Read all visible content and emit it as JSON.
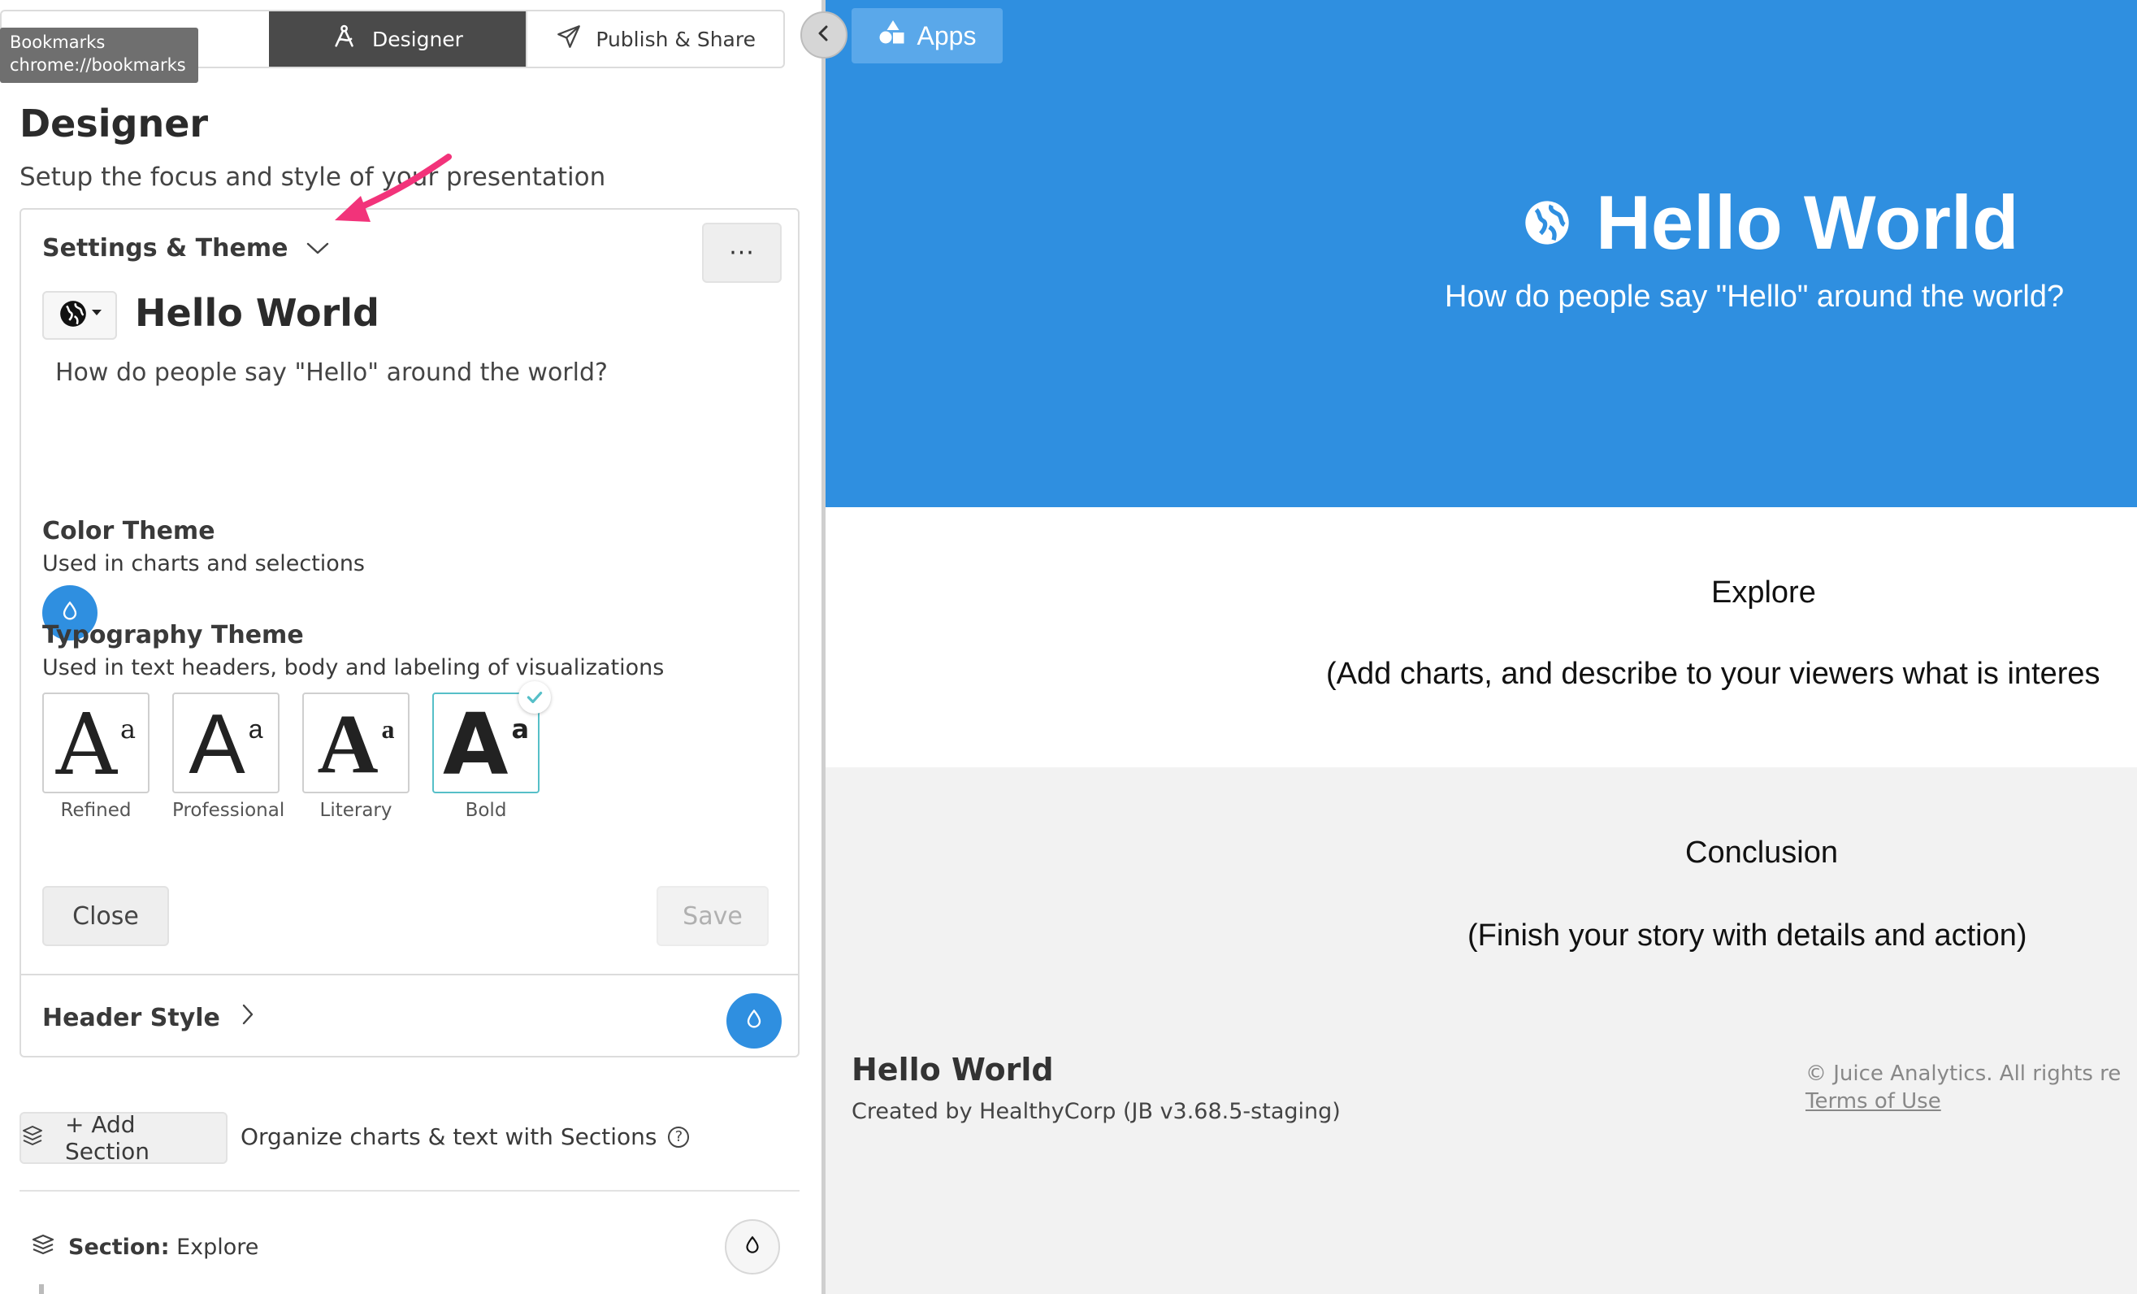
{
  "tabs": {
    "designer_label": "Designer",
    "publish_label": "Publish & Share"
  },
  "tooltip": {
    "line1": "Bookmarks",
    "line2": "chrome://bookmarks"
  },
  "designer": {
    "title": "Designer",
    "subtitle": "Setup the focus and style of your presentation"
  },
  "settings": {
    "title": "Settings & Theme",
    "more_label": "···",
    "presentation_title": "Hello World",
    "presentation_subtitle": "How do people say \"Hello\" around the world?",
    "color_theme": {
      "heading": "Color Theme",
      "description": "Used in charts and selections",
      "color": "#2f8fe0"
    },
    "typography_theme": {
      "heading": "Typography Theme",
      "description": "Used in text headers, body and labeling of visualizations",
      "options": [
        {
          "label": "Refined",
          "glyph": "A",
          "small": "a"
        },
        {
          "label": "Professional",
          "glyph": "A",
          "small": "a"
        },
        {
          "label": "Literary",
          "glyph": "A",
          "small": "a"
        },
        {
          "label": "Bold",
          "glyph": "A",
          "small": "a",
          "selected": true
        }
      ]
    },
    "close_label": "Close",
    "save_label": "Save"
  },
  "header_style": {
    "title": "Header Style"
  },
  "add_section": {
    "label": "+ Add Section",
    "help": "Organize charts & text with Sections",
    "help_icon": "?"
  },
  "section_row": {
    "prefix": "Section:",
    "name": "Explore"
  },
  "preview": {
    "apps_label": "Apps",
    "hero_title": "Hello World",
    "hero_subtitle": "How do people say \"Hello\" around the world?",
    "hero_color": "#2f8fe0",
    "explore_heading": "Explore",
    "explore_text": "(Add charts, and describe to your viewers what is interes",
    "conclusion_heading": "Conclusion",
    "conclusion_text": "(Finish your story with details and action)",
    "footer_title": "Hello World",
    "footer_subtitle": "Created by HealthyCorp (JB v3.68.5-staging)",
    "footer_copyright": "© Juice Analytics. All rights re",
    "footer_terms": "Terms of Use"
  }
}
